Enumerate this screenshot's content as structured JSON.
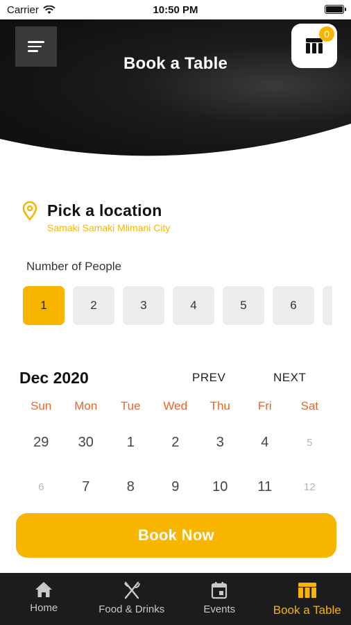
{
  "status_bar": {
    "carrier": "Carrier",
    "time": "10:50 PM"
  },
  "header": {
    "title": "Book a Table",
    "cart_count": "0"
  },
  "location": {
    "title": "Pick a location",
    "subtitle": "Samaki Samaki Mlimani City"
  },
  "people": {
    "label": "Number of People",
    "options": [
      "1",
      "2",
      "3",
      "4",
      "5",
      "6"
    ],
    "selected": "1"
  },
  "calendar": {
    "month": "Dec 2020",
    "prev_label": "PREV",
    "next_label": "NEXT",
    "weekdays": [
      "Sun",
      "Mon",
      "Tue",
      "Wed",
      "Thu",
      "Fri",
      "Sat"
    ],
    "weeks": [
      [
        "29",
        "30",
        "1",
        "2",
        "3",
        "4",
        "5"
      ],
      [
        "6",
        "7",
        "8",
        "9",
        "10",
        "11",
        "12"
      ]
    ]
  },
  "book_button": "Book Now",
  "tabs": [
    {
      "label": "Home",
      "icon": "home-icon"
    },
    {
      "label": "Food & Drinks",
      "icon": "fork-knife-icon"
    },
    {
      "label": "Events",
      "icon": "calendar-icon"
    },
    {
      "label": "Book a Table",
      "icon": "table-icon",
      "active": true
    }
  ],
  "colors": {
    "accent": "#f7b500",
    "weekday": "#f26322",
    "tab_bar": "#1c1c1c"
  }
}
